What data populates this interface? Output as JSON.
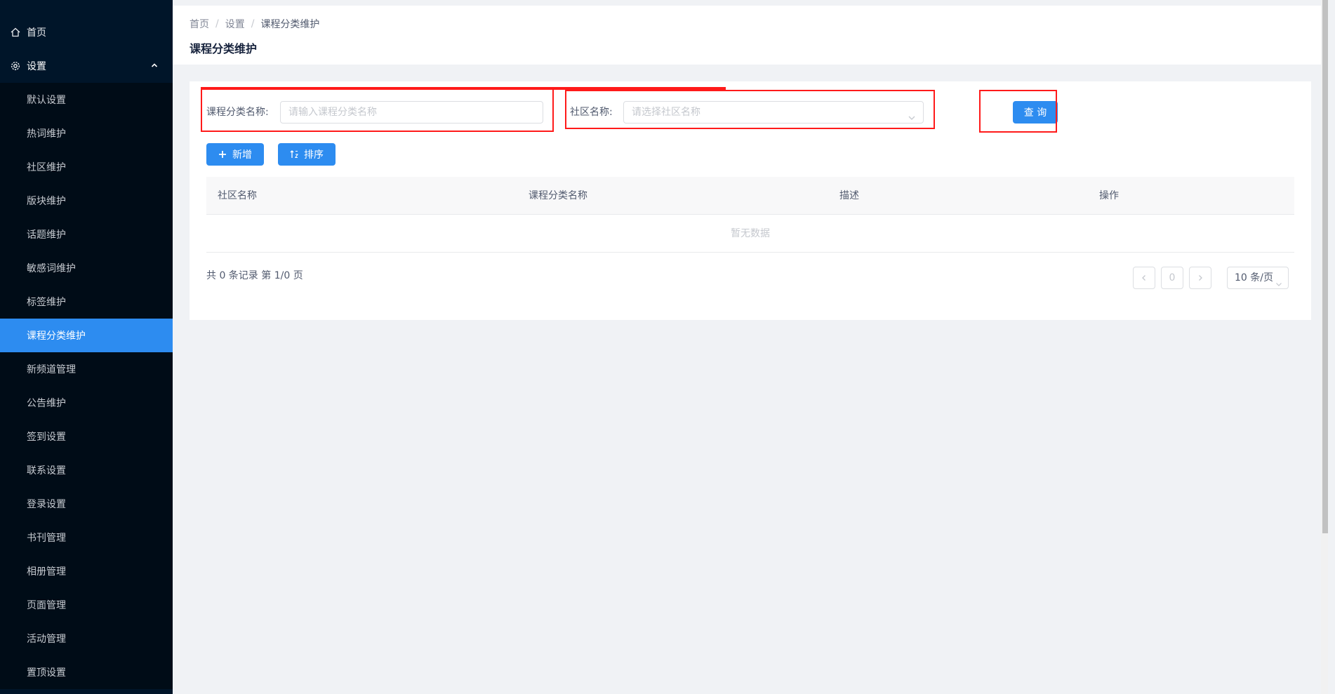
{
  "sidebar": {
    "home_label": "首页",
    "settings_label": "设置",
    "items": [
      {
        "label": "默认设置"
      },
      {
        "label": "热词维护"
      },
      {
        "label": "社区维护"
      },
      {
        "label": "版块维护"
      },
      {
        "label": "话题维护"
      },
      {
        "label": "敏感词维护"
      },
      {
        "label": "标签维护"
      },
      {
        "label": "课程分类维护"
      },
      {
        "label": "新频道管理"
      },
      {
        "label": "公告维护"
      },
      {
        "label": "签到设置"
      },
      {
        "label": "联系设置"
      },
      {
        "label": "登录设置"
      },
      {
        "label": "书刊管理"
      },
      {
        "label": "相册管理"
      },
      {
        "label": "页面管理"
      },
      {
        "label": "活动管理"
      },
      {
        "label": "置顶设置"
      }
    ],
    "active_label": "课程分类维护"
  },
  "breadcrumb": {
    "home": "首页",
    "settings": "设置",
    "current": "课程分类维护",
    "separator": "/"
  },
  "page_title": "课程分类维护",
  "filters": {
    "category_label": "课程分类名称:",
    "category_placeholder": "请输入课程分类名称",
    "community_label": "社区名称:",
    "community_placeholder": "请选择社区名称",
    "query_button": "查 询"
  },
  "toolbar": {
    "add_button": "新增",
    "sort_button": "排序"
  },
  "table": {
    "columns": [
      "社区名称",
      "课程分类名称",
      "描述",
      "操作"
    ],
    "empty_text": "暂无数据"
  },
  "pagination": {
    "summary": "共 0 条记录 第 1/0 页",
    "current_page": "0",
    "page_size": "10 条/页"
  },
  "colors": {
    "sidebar_bg": "#001529",
    "primary": "#2d8cf0",
    "highlight_box": "#ff1a1a"
  }
}
